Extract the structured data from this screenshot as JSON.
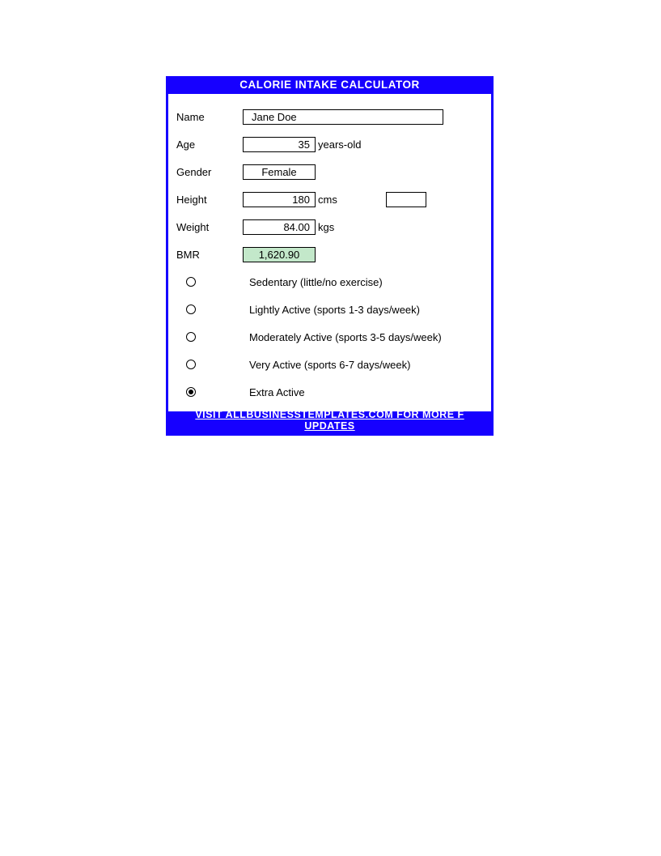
{
  "header": {
    "title": "CALORIE INTAKE CALCULATOR"
  },
  "form": {
    "name_label": "Name",
    "name_value": "Jane Doe",
    "age_label": "Age",
    "age_value": "35",
    "age_unit": "years-old",
    "gender_label": "Gender",
    "gender_value": "Female",
    "height_label": "Height",
    "height_value": "180",
    "height_unit": "cms",
    "weight_label": "Weight",
    "weight_value": "84.00",
    "weight_unit": "kgs",
    "bmr_label": "BMR",
    "bmr_value": "1,620.90"
  },
  "activity": {
    "options": [
      {
        "label": "Sedentary (little/no exercise)",
        "selected": false
      },
      {
        "label": "Lightly Active (sports 1-3 days/week)",
        "selected": false
      },
      {
        "label": "Moderately Active (sports 3-5 days/week)",
        "selected": false
      },
      {
        "label": "Very Active (sports 6-7 days/week)",
        "selected": false
      },
      {
        "label": "Extra Active",
        "selected": true
      }
    ]
  },
  "footer": {
    "line1": "VISIT ALLBUSINESSTEMPLATES.COM FOR MORE F",
    "line2": "UPDATES"
  }
}
